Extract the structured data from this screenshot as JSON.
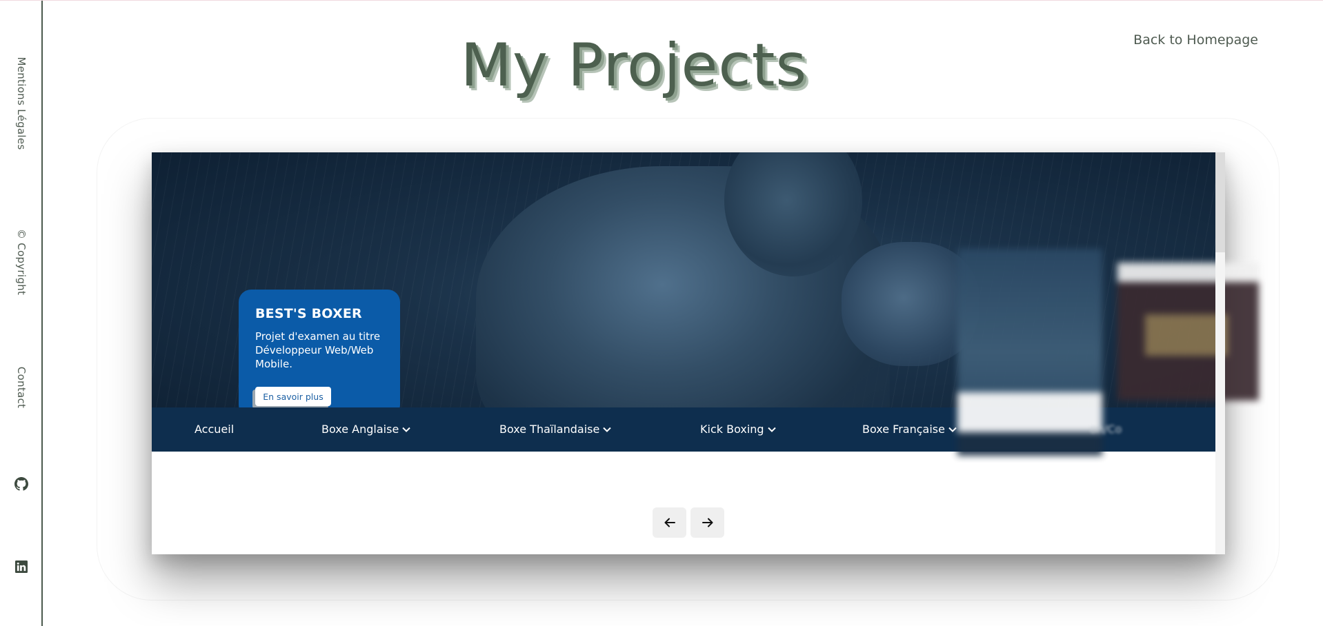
{
  "page": {
    "title": "My Projects",
    "back_link": "Back to Homepage"
  },
  "sidebar": {
    "links": [
      "Mentions Légales",
      "© Copyright",
      "Contact"
    ],
    "icons": [
      "github-icon",
      "linkedin-icon"
    ]
  },
  "project": {
    "title": "BEST'S BOXER",
    "description": "Projet d'examen au titre Développeur Web/Web Mobile.",
    "button_label": "En savoir plus"
  },
  "navbar": {
    "items": [
      {
        "label": "Accueil",
        "dropdown": false
      },
      {
        "label": "Boxe Anglaise",
        "dropdown": true
      },
      {
        "label": "Boxe Thaïlandaise",
        "dropdown": true
      },
      {
        "label": "Kick Boxing",
        "dropdown": true
      },
      {
        "label": "Boxe Française",
        "dropdown": true
      }
    ],
    "peek_text": "on/Co"
  },
  "carousel": {
    "prev_icon": "arrow-left-icon",
    "next_icon": "arrow-right-icon"
  },
  "colors": {
    "title": "#4d604f",
    "info_box": "#0b5ba8",
    "navbar": "#0e2e4e"
  }
}
